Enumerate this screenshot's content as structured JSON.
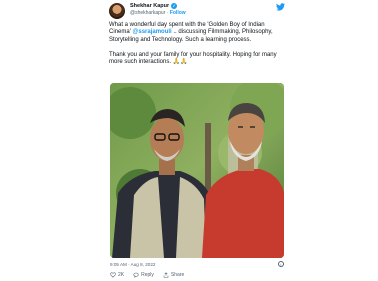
{
  "tweet": {
    "author_name": "Shekhar Kapur",
    "author_handle": "@shekharkapur",
    "separator": "·",
    "follow_label": "Follow",
    "text_p1_a": "What a wonderful day spent with the 'Golden Boy of Indian Cinema' ",
    "mention": "@ssrajamouli",
    "text_p1_b": " .. discussing Filmmaking, Philosophy, Storytelling and Technology. Such a learning process.",
    "text_p2": "Thank you and your family for your hospitality. Hoping for many more such interactions. 🙏🙏",
    "time": "9:05 AM · Aug 8, 2022",
    "like_count": "2K",
    "reply_label": "Reply",
    "share_label": "Share",
    "info_glyph": "i"
  },
  "colors": {
    "accent": "#1d9bf0",
    "text": "#0f1419",
    "muted": "#536471",
    "like": "#f91880"
  },
  "icons": [
    "verified-badge-icon",
    "twitter-bird-icon",
    "heart-icon",
    "reply-icon",
    "share-icon",
    "info-icon"
  ]
}
